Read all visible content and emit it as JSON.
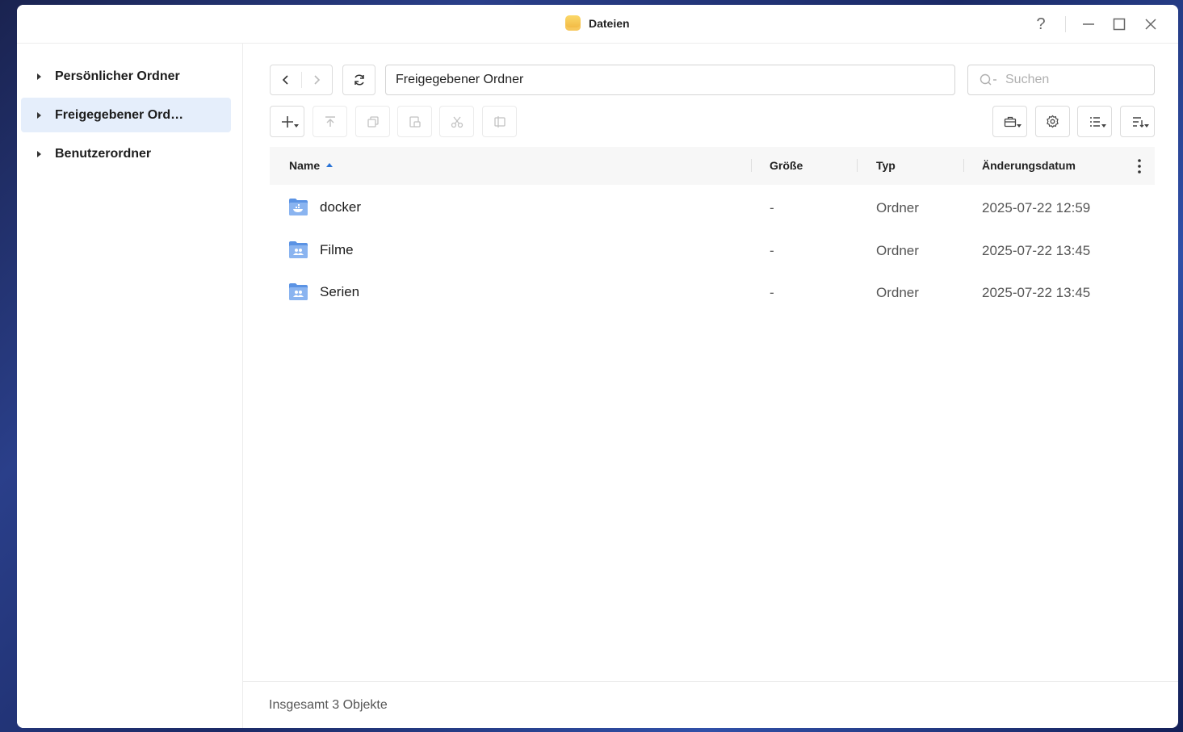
{
  "window": {
    "title": "Dateien",
    "help": "?"
  },
  "sidebar": {
    "items": [
      {
        "label": "Persönlicher Ordner"
      },
      {
        "label": "Freigegebener Ord…"
      },
      {
        "label": "Benutzerordner"
      }
    ]
  },
  "toolbar": {
    "path": "Freigegebener Ordner",
    "search_placeholder": "Suchen"
  },
  "table": {
    "columns": [
      "Name",
      "Größe",
      "Typ",
      "Änderungsdatum"
    ],
    "rows": [
      {
        "name": "docker",
        "size": "-",
        "type": "Ordner",
        "modified": "2025-07-22 12:59",
        "icon": "docker-folder-icon"
      },
      {
        "name": "Filme",
        "size": "-",
        "type": "Ordner",
        "modified": "2025-07-22 13:45",
        "icon": "shared-folder-icon"
      },
      {
        "name": "Serien",
        "size": "-",
        "type": "Ordner",
        "modified": "2025-07-22 13:45",
        "icon": "shared-folder-icon"
      }
    ]
  },
  "footer": {
    "summary": "Insgesamt 3 Objekte"
  },
  "colors": {
    "accent": "#2a73d6",
    "selected_bg": "#e5eefb",
    "folder": "#5b93e4"
  }
}
